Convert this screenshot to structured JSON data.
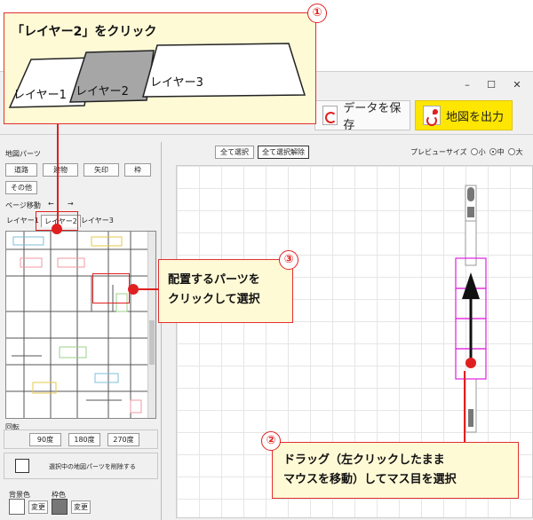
{
  "callouts": {
    "step1": {
      "number": "①",
      "text": "「レイヤー2」をクリック",
      "layers": [
        "レイヤー1",
        "レイヤー2",
        "レイヤー3"
      ]
    },
    "step2": {
      "number": "②",
      "line1": "ドラッグ（左クリックしたまま",
      "line2": "マウスを移動）してマス目を選択"
    },
    "step3": {
      "number": "③",
      "line1": "配置するパーツを",
      "line2": "クリックして選択"
    }
  },
  "window": {
    "minimize": "–",
    "maximize": "☐",
    "close": "✕"
  },
  "toolbar": {
    "save_label": "データを保存",
    "output_label": "地図を出力"
  },
  "left_panel": {
    "parts_title": "地図パーツ",
    "part_buttons": [
      "道路",
      "建物",
      "矢印",
      "枠"
    ],
    "other_button": "その他",
    "page_move_label": "ページ移動",
    "page_prev": "←",
    "page_next": "→",
    "tabs": [
      "レイヤー1",
      "レイヤー2",
      "レイヤー3"
    ],
    "rotate_label": "回転",
    "rotate_buttons": [
      "90度",
      "180度",
      "270度"
    ],
    "delete_label": "選択中の地図パーツを削除する",
    "bg_color_label": "背景色",
    "frame_color_label": "枠色",
    "change_label": "変更"
  },
  "preview": {
    "select_all": "全て選択",
    "deselect_all": "全て選択解除",
    "size_label": "プレビューサイズ",
    "sizes": [
      "小",
      "中",
      "大"
    ],
    "selected_size": "中"
  },
  "colors": {
    "accent_red": "#e02020",
    "callout_bg": "#fffad6",
    "output_yellow": "#ffe600",
    "selection_magenta": "#e020e0"
  }
}
